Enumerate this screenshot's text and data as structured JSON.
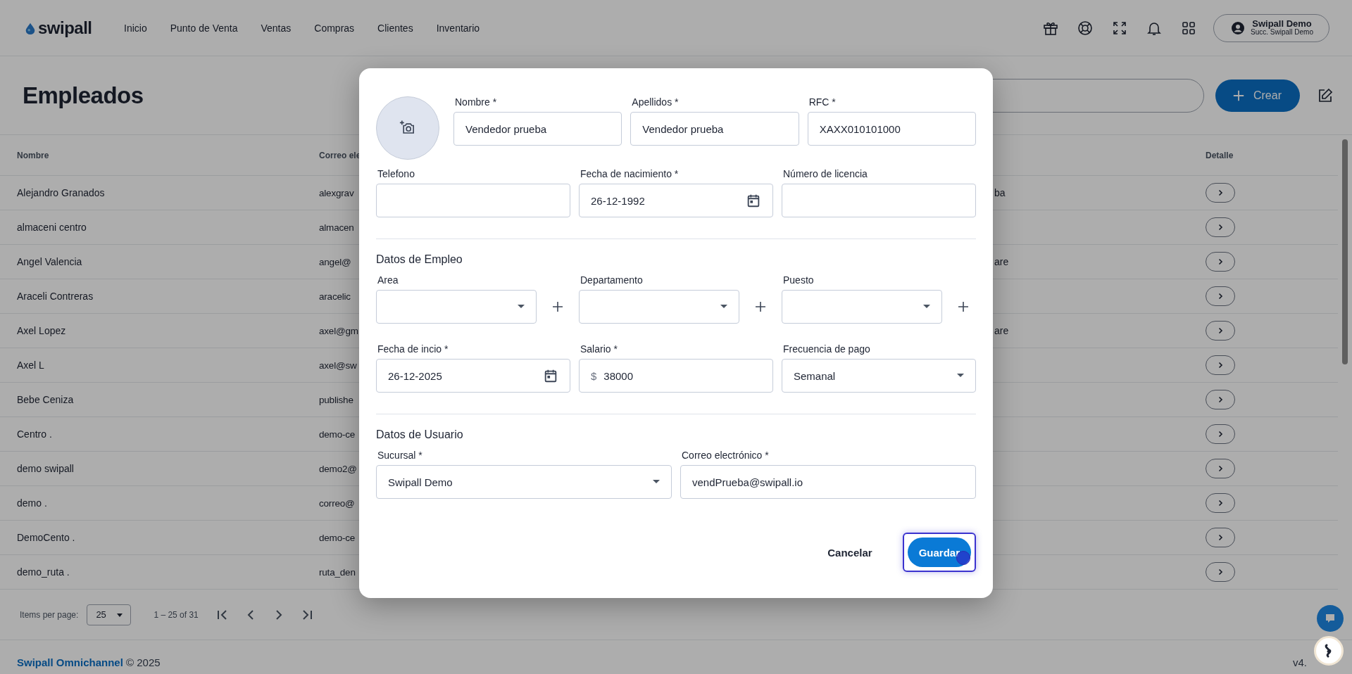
{
  "header": {
    "logo": "swipall",
    "nav": [
      "Inicio",
      "Punto de Venta",
      "Ventas",
      "Compras",
      "Clientes",
      "Inventario"
    ],
    "user": {
      "name": "Swipall Demo",
      "branch": "Succ. Swipall Demo"
    }
  },
  "page": {
    "title": "Empleados",
    "create_button": "Crear"
  },
  "table": {
    "columns": [
      "Nombre",
      "Correo ele",
      "Detalle"
    ],
    "rows": [
      {
        "name": "Alejandro Granados",
        "email": "alexgrav",
        "column_3": "ba"
      },
      {
        "name": "almaceni centro",
        "email": "almacen"
      },
      {
        "name": "Angel Valencia",
        "email": "angel@",
        "column_3": "are"
      },
      {
        "name": "Araceli Contreras",
        "email": "aracelic"
      },
      {
        "name": "Axel Lopez",
        "email": "axel@gm",
        "column_3": "are"
      },
      {
        "name": "Axel L",
        "email": "axel@sw"
      },
      {
        "name": "Bebe Ceniza",
        "email": "publishe"
      },
      {
        "name": "Centro .",
        "email": "demo-ce"
      },
      {
        "name": "demo swipall",
        "email": "demo2@"
      },
      {
        "name": "demo .",
        "email": "correo@"
      },
      {
        "name": "DemoCento .",
        "email": "demo-ce"
      },
      {
        "name": "demo_ruta .",
        "email": "ruta_den"
      }
    ]
  },
  "pagination": {
    "label": "Items per page:",
    "page_size": "25",
    "range": "1 – 25 of 31"
  },
  "footer": {
    "brand": "Swipall Omnichannel",
    "copyright": "© 2025",
    "version": "v4."
  },
  "modal": {
    "sections": [
      {
        "rows": [
          [
            {
              "label": "Nombre *",
              "kind": "text",
              "value": "Vendedor prueba"
            },
            {
              "label": "Apellidos *",
              "kind": "text",
              "value": "Vendedor prueba"
            },
            {
              "label": "RFC *",
              "kind": "text",
              "value": "XAXX010101000"
            }
          ],
          [
            {
              "label": "Telefono",
              "kind": "text"
            },
            {
              "label": "Fecha de nacimiento *",
              "kind": "date",
              "value": "26-12-1992"
            },
            {
              "label": "Número de licencia",
              "kind": "text"
            }
          ]
        ]
      },
      {
        "title": "Datos de Empleo",
        "rows": [
          [
            {
              "label": "Area",
              "kind": "select",
              "addable": true
            },
            {
              "label": "Departamento",
              "kind": "select",
              "addable": true
            },
            {
              "label": "Puesto",
              "kind": "select",
              "addable": true
            }
          ],
          [
            {
              "label": "Fecha de incio *",
              "kind": "date",
              "value": "26-12-2025"
            },
            {
              "label": "Salario *",
              "kind": "money",
              "prefix": "$",
              "value": "38000"
            },
            {
              "label": "Frecuencia de pago",
              "kind": "select",
              "value": "Semanal"
            }
          ]
        ]
      },
      {
        "title": "Datos de Usuario",
        "rows": [
          [
            {
              "label": "Sucursal *",
              "kind": "select",
              "value": "Swipall Demo"
            },
            {
              "label": "Correo electrónico *",
              "kind": "text",
              "value": "vendPrueba@swipall.io"
            }
          ]
        ]
      }
    ],
    "buttons": [
      {
        "label": "Cancelar",
        "kind": "text",
        "focused": false
      },
      {
        "label": "Guardar",
        "kind": "primary",
        "focused": true
      }
    ]
  }
}
